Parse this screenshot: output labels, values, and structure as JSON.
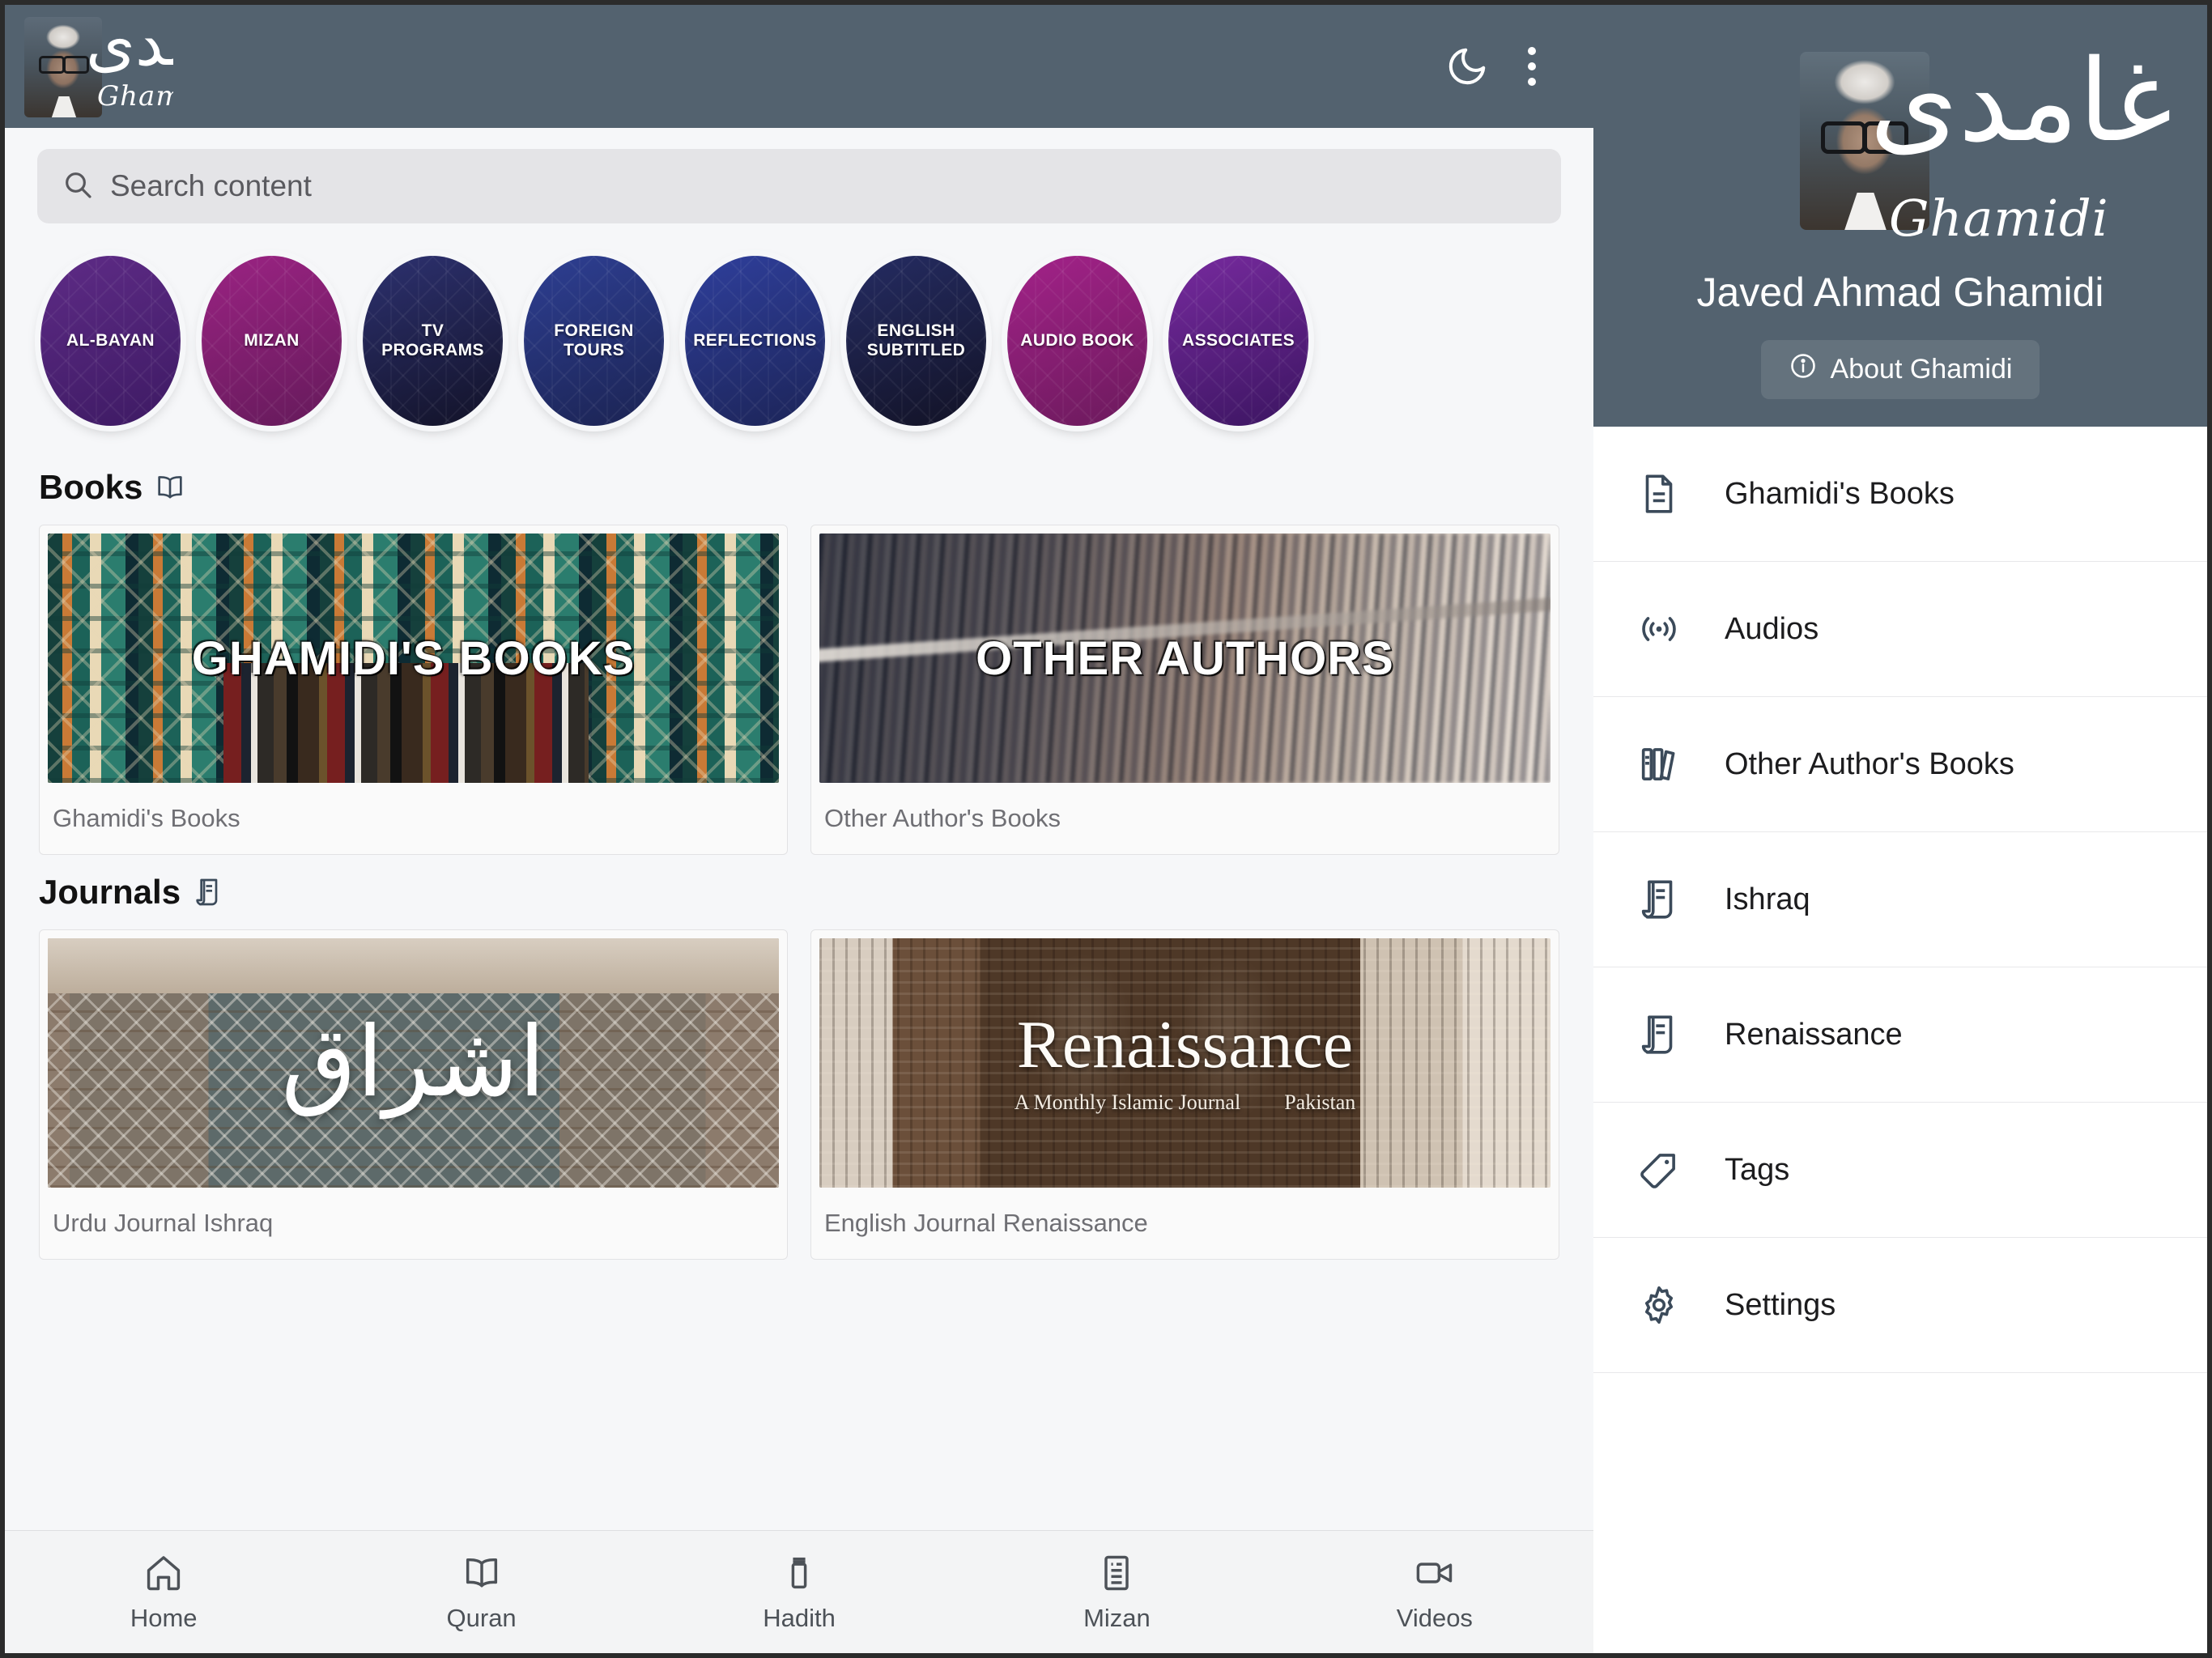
{
  "appbar": {
    "brand_urdu": "غامدی",
    "brand_latin": "Ghamidi",
    "darkmode_icon": "moon-icon",
    "overflow_icon": "three-dots-icon"
  },
  "search": {
    "placeholder": "Search content",
    "value": "",
    "icon": "search-icon"
  },
  "categories": [
    {
      "label": "AL-BAYAN",
      "color_from": "#4a2170",
      "color_to": "#5e2b86"
    },
    {
      "label": "MIZAN",
      "color_from": "#8e1f74",
      "color_to": "#6b1a63"
    },
    {
      "label": "TV\nPROGRAMS",
      "color_from": "#2a2e63",
      "color_to": "#17182f"
    },
    {
      "label": "FOREIGN\nTOURS",
      "color_from": "#2a3a86",
      "color_to": "#1d2559"
    },
    {
      "label": "REFLECTIONS",
      "color_from": "#2b3a92",
      "color_to": "#202a5e"
    },
    {
      "label": "ENGLISH\nSUBTITLED",
      "color_from": "#232a5e",
      "color_to": "#14152b"
    },
    {
      "label": "AUDIO BOOK",
      "color_from": "#9b2083",
      "color_to": "#6d1a5e"
    },
    {
      "label": "ASSOCIATES",
      "color_from": "#6b2491",
      "color_to": "#3f1766"
    }
  ],
  "sections": [
    {
      "title": "Books",
      "icon": "open-book-icon",
      "cards": [
        {
          "overlay_title": "GHAMIDI'S BOOKS",
          "caption": "Ghamidi's Books",
          "art": "art-tiles"
        },
        {
          "overlay_title": "OTHER AUTHORS",
          "caption": "Other Author's Books",
          "art": "art-shelf"
        }
      ]
    },
    {
      "title": "Journals",
      "icon": "journal-icon",
      "cards": [
        {
          "overlay_title": "اشراق",
          "caption": "Urdu Journal Ishraq",
          "art": "art-ishraq"
        },
        {
          "overlay_title": "Renaissance",
          "caption": "English Journal Renaissance",
          "art": "art-renaissance",
          "sub_left": "A Monthly Islamic Journal",
          "sub_right": "Pakistan"
        }
      ]
    }
  ],
  "bottom_nav": [
    {
      "label": "Home",
      "icon": "home-icon"
    },
    {
      "label": "Quran",
      "icon": "open-book-icon"
    },
    {
      "label": "Hadith",
      "icon": "scroll-icon"
    },
    {
      "label": "Mizan",
      "icon": "document-list-icon"
    },
    {
      "label": "Videos",
      "icon": "video-camera-icon"
    }
  ],
  "sidebar": {
    "brand_urdu": "غامدی",
    "brand_latin": "Ghamidi",
    "name": "Javed Ahmad Ghamidi",
    "about_label": "About Ghamidi",
    "about_icon": "info-circle-icon",
    "items": [
      {
        "label": "Ghamidi's Books",
        "icon": "document-icon"
      },
      {
        "label": "Audios",
        "icon": "broadcast-icon"
      },
      {
        "label": "Other Author's Books",
        "icon": "books-icon"
      },
      {
        "label": "Ishraq",
        "icon": "journal-icon"
      },
      {
        "label": "Renaissance",
        "icon": "journal-icon"
      },
      {
        "label": "Tags",
        "icon": "tag-icon"
      },
      {
        "label": "Settings",
        "icon": "gear-icon"
      }
    ]
  },
  "colors": {
    "header_bg": "#53626f",
    "page_bg": "#f6f7f9",
    "search_bg": "#e4e4e7",
    "icon_stroke": "#3b4a5a",
    "frame": "#2b2b2b"
  }
}
